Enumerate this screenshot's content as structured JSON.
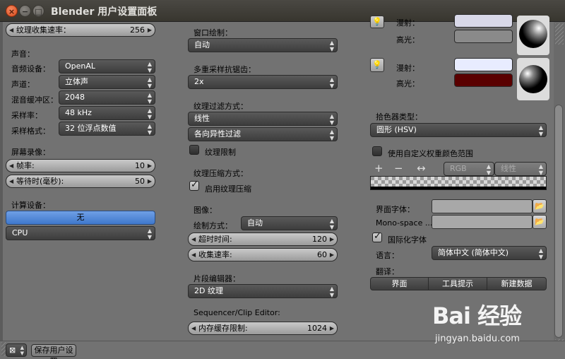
{
  "window": {
    "title": "Blender 用户设置面板",
    "close_glyph": "×",
    "min_glyph": "−",
    "max_glyph": "□"
  },
  "left": {
    "field_top": {
      "label": "纹理收集速率：",
      "value": "256"
    },
    "section_sound": "声音：",
    "audio_device_label": "音频设备：",
    "audio_device_value": "OpenAL",
    "channels_label": "声道：",
    "channels_value": "立体声",
    "mix_buffer_label": "混音缓冲区：",
    "mix_buffer_value": "2048",
    "sample_rate_label": "采样率：",
    "sample_rate_value": "48 kHz",
    "sample_format_label": "采样格式：",
    "sample_format_value": "32 位浮点数值",
    "section_screencast": "屏幕录像：",
    "fps_label": "帧率:",
    "fps_value": "10",
    "wait_label": "等待时(毫秒):",
    "wait_value": "50",
    "section_compute": "计算设备：",
    "compute_blue_value": "无",
    "compute_device_value": "CPU"
  },
  "middle": {
    "window_draw_label": "窗口绘制：",
    "window_draw_value": "自动",
    "multisample_label": "多重采样抗锯齿：",
    "multisample_value": "2x",
    "texture_filter_label": "纹理过滤方式：",
    "texture_filter_value": "线性",
    "anisotropic_value": "各向异性过滤",
    "gpu_mipmap_label": "纹理限制",
    "tex_compress_label": "纹理压缩方式：",
    "tex_compress_check_label": "启用纹理压缩",
    "images_label": "图像：",
    "image_draw_label": "绘制方式：",
    "image_draw_value": "自动",
    "time_out_label": "超时时间:",
    "time_out_value": "120",
    "collect_rate_label": "收集速率:",
    "collect_rate_value": "60",
    "clip_label": "片段编辑器：",
    "clip_value": "2D 纹理",
    "sequencer_label": "Sequencer/Clip Editor:",
    "cache_label": "内存缓存限制:",
    "cache_value": "1024"
  },
  "right": {
    "light1_diffuse_label": "漫射：",
    "light1_specular_label": "高光：",
    "light2_diffuse_label": "漫射：",
    "light2_specular_label": "高光：",
    "color_picker_label": "拾色器类型：",
    "color_picker_value": "圆形 (HSV)",
    "custom_weight_label": "使用自定义权重颜色范围",
    "plus_glyph": "+",
    "minus_glyph": "−",
    "flip_glyph": "↔",
    "rgb_value": "RGB",
    "interp_value": "线性",
    "interface_font_label": "界面字体：",
    "mono_font_label": "Mono-space ...",
    "translate_label": "国际化字体",
    "language_label": "语言：",
    "language_value": "简体中文 (简体中文)",
    "translate_group_label": "翻译：",
    "translate_btn1": "界面",
    "translate_btn2": "工具提示",
    "translate_btn3": "新建数据",
    "folder_glyph": "📂"
  },
  "bottom": {
    "editor_glyph": "⊠",
    "save_button": "保存用户设置"
  },
  "watermark": {
    "text": "Bai 经验",
    "url": "jingyan.baidu.com"
  },
  "colors": {
    "blue_button": "#4f86d6",
    "light1_diffuse": "#d8d8e8",
    "light1_specular": "#8a8a8a",
    "light2_diffuse": "#e8ecff",
    "light2_specular": "#5a0000"
  }
}
